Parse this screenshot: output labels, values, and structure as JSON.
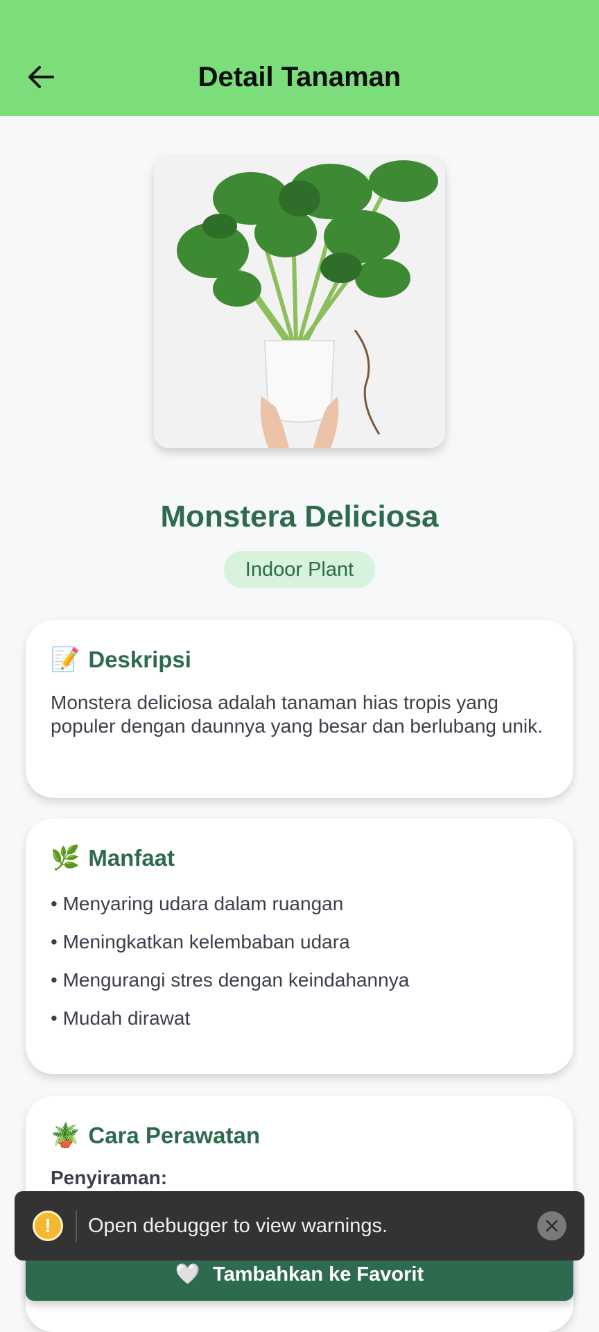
{
  "header": {
    "title": "Detail Tanaman",
    "back_icon": "arrow-left-icon"
  },
  "plant": {
    "name": "Monstera Deliciosa",
    "category": "Indoor Plant",
    "image": "monstera-plant-photo"
  },
  "description": {
    "emoji": "📝",
    "title": "Deskripsi",
    "text": "Monstera deliciosa adalah tanaman hias tropis yang populer dengan daunnya yang besar dan berlubang unik."
  },
  "benefits": {
    "emoji": "🌿",
    "title": "Manfaat",
    "items": [
      "• Menyaring udara dalam ruangan",
      "• Meningkatkan kelembaban udara",
      "• Mengurangi stres dengan keindahannya",
      "• Mudah dirawat"
    ]
  },
  "care": {
    "emoji": "🪴",
    "title": "Cara Perawatan",
    "watering_label": "Penyiraman:"
  },
  "favorite_button": {
    "icon": "🤍",
    "label": "Tambahkan ke Favorit"
  },
  "toast": {
    "message": "Open debugger to view warnings.",
    "icon": "!"
  },
  "colors": {
    "header": "#7bde7b",
    "primary": "#2e6a4e",
    "tag_bg": "#d7f3dc",
    "toast_bg": "#333333",
    "warn": "#f5b82e"
  }
}
